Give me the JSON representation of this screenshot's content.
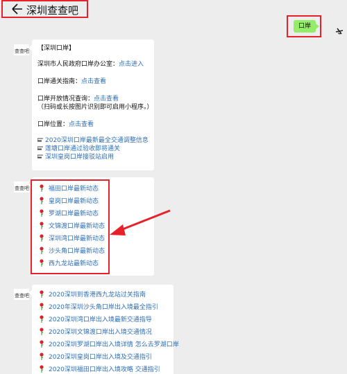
{
  "header": {
    "back_icon": "back-arrow-icon",
    "title": "深圳查查吧"
  },
  "user_message": {
    "text": "口岸"
  },
  "message1": {
    "heading": "【深圳口岸】",
    "office_label": "深圳市人民政府口岸办公室：",
    "office_link": "点击进入",
    "guide_label": "口岸通关指南：",
    "guide_link": "点击查看",
    "open_label": "口岸开放情况查询：",
    "open_link": "点击查看",
    "open_note": "（扫码或长按图片识别即可启用小程序。）",
    "location_label": "口岸位置：",
    "location_link": "点击查看",
    "news": [
      "2020深圳口岸最新最全交通调整信息",
      "莲塘口岸通过验收即将通关",
      "深圳皇岗口岸接驳站启用"
    ]
  },
  "message2": {
    "items": [
      "福田口岸最新动态",
      "皇岗口岸最新动态",
      "罗湖口岸最新动态",
      "文锦渡口岸最新动态",
      "深圳湾口岸最新动态",
      "沙头角口岸最新动态",
      "西九龙站最新动态"
    ]
  },
  "message3": {
    "items": [
      "2020深圳到香港西九龙站过关指南",
      "2020年深圳沙头角口岸出入境最全指引",
      "2020深圳湾口岸出入境最新交通指导",
      "2020深圳文锦渡口岸出入境交通情况",
      "2020深圳罗湖口岸出入境详情 怎么去罗湖口岸",
      "2020深圳皇岗口岸出入境及交通指引",
      "2020深圳福田口岸出入境攻略 交通指引"
    ]
  },
  "colors": {
    "background": "#ededed",
    "link": "#2d6fb7",
    "highlight": "#e8202a",
    "user_bubble": "#95ec69"
  }
}
